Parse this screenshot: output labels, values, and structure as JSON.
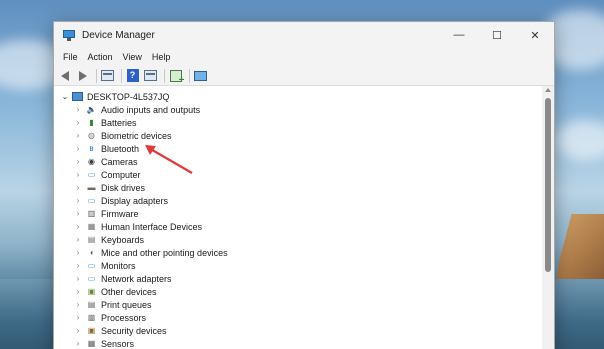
{
  "window": {
    "title": "Device Manager",
    "minimize_glyph": "—",
    "maximize_glyph": "☐",
    "close_glyph": "✕"
  },
  "menu": [
    "File",
    "Action",
    "View",
    "Help"
  ],
  "toolbar": {
    "icons": [
      "back-arrow-icon",
      "forward-arrow-icon",
      "properties-icon",
      "help-icon",
      "show-hide-icon",
      "scan-hardware-icon",
      "monitor-icon"
    ]
  },
  "tree": {
    "root_label": "DESKTOP-4L537JQ",
    "items": [
      {
        "label": "Audio inputs and outputs",
        "icon": "speaker-icon",
        "glyph": "🔈",
        "color": "#4a4a4a"
      },
      {
        "label": "Batteries",
        "icon": "battery-icon",
        "glyph": "▮",
        "color": "#2f8a2f"
      },
      {
        "label": "Biometric devices",
        "icon": "fingerprint-icon",
        "glyph": "◍",
        "color": "#7a7a7a"
      },
      {
        "label": "Bluetooth",
        "icon": "bluetooth-icon",
        "glyph": "ʙ",
        "color": "#1f6fd1"
      },
      {
        "label": "Cameras",
        "icon": "camera-icon",
        "glyph": "◉",
        "color": "#3a3a3a"
      },
      {
        "label": "Computer",
        "icon": "computer-icon",
        "glyph": "▭",
        "color": "#3b8fd9"
      },
      {
        "label": "Disk drives",
        "icon": "disk-drive-icon",
        "glyph": "▬",
        "color": "#6a6a6a"
      },
      {
        "label": "Display adapters",
        "icon": "display-adapter-icon",
        "glyph": "▭",
        "color": "#3b8fd9"
      },
      {
        "label": "Firmware",
        "icon": "firmware-icon",
        "glyph": "▥",
        "color": "#5a5a5a"
      },
      {
        "label": "Human Interface Devices",
        "icon": "hid-icon",
        "glyph": "▦",
        "color": "#6a6a6a"
      },
      {
        "label": "Keyboards",
        "icon": "keyboard-icon",
        "glyph": "▤",
        "color": "#6a6a6a"
      },
      {
        "label": "Mice and other pointing devices",
        "icon": "mouse-icon",
        "glyph": "◖",
        "color": "#5a5a5a"
      },
      {
        "label": "Monitors",
        "icon": "monitor-icon",
        "glyph": "▭",
        "color": "#3b8fd9"
      },
      {
        "label": "Network adapters",
        "icon": "network-adapter-icon",
        "glyph": "▭",
        "color": "#3b8fd9"
      },
      {
        "label": "Other devices",
        "icon": "other-devices-icon",
        "glyph": "▣",
        "color": "#6a8a3a"
      },
      {
        "label": "Print queues",
        "icon": "printer-icon",
        "glyph": "▤",
        "color": "#5a5a5a"
      },
      {
        "label": "Processors",
        "icon": "processor-icon",
        "glyph": "▩",
        "color": "#7a7a7a"
      },
      {
        "label": "Security devices",
        "icon": "security-device-icon",
        "glyph": "▣",
        "color": "#8a6a2a"
      },
      {
        "label": "Sensors",
        "icon": "sensor-icon",
        "glyph": "▦",
        "color": "#5a5a5a"
      }
    ]
  },
  "annotation": {
    "color": "#e03a3a"
  }
}
